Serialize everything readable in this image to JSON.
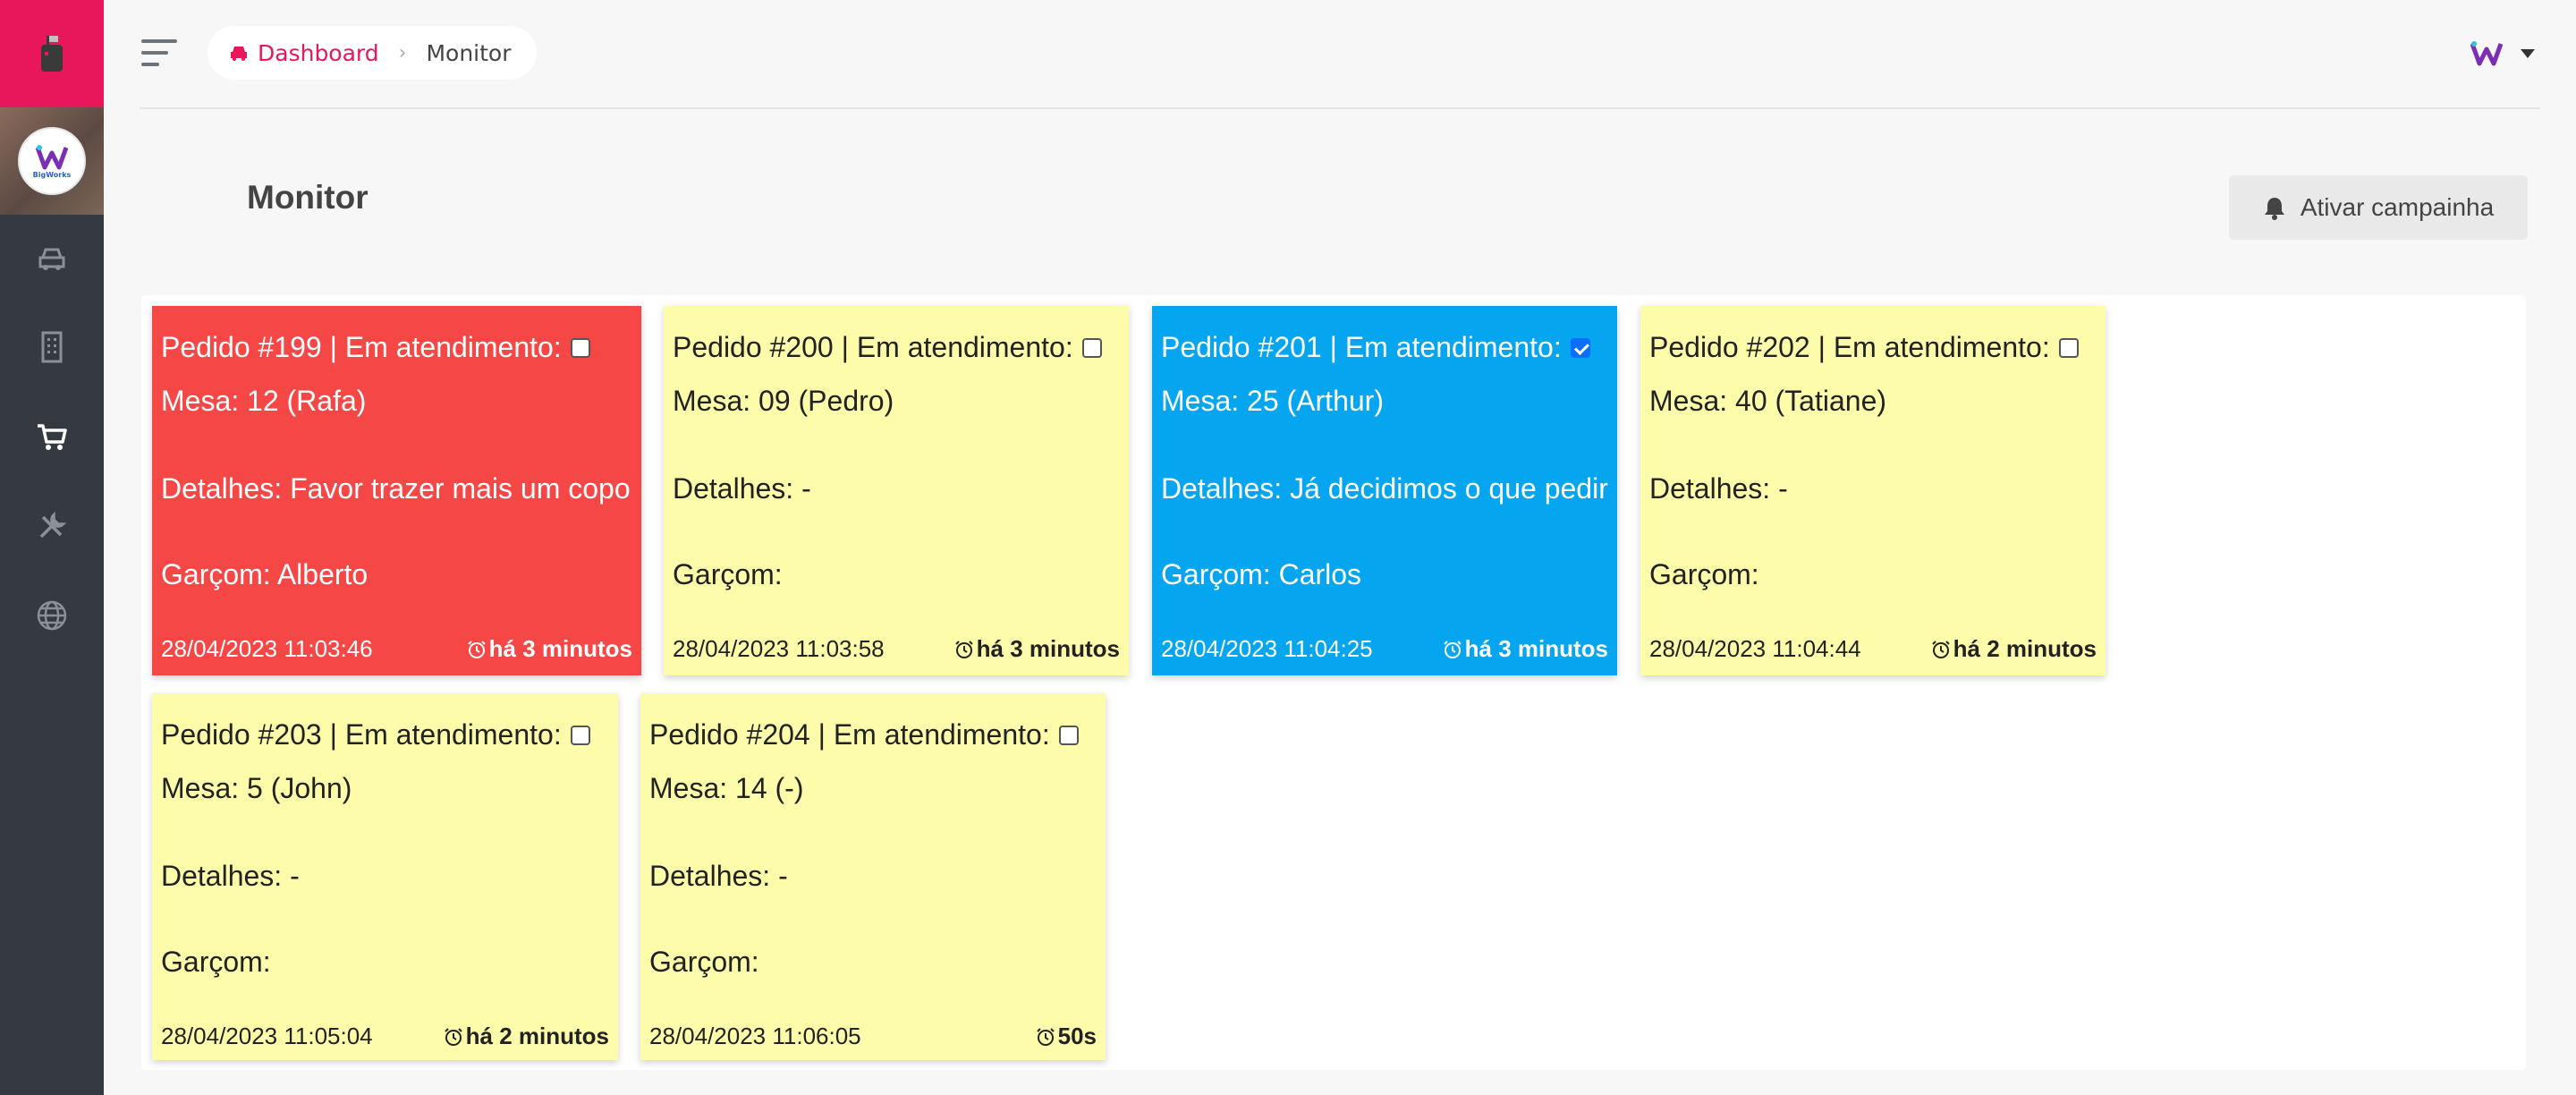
{
  "header": {
    "breadcrumb_home": "Dashboard",
    "breadcrumb_current": "Monitor"
  },
  "page": {
    "title": "Monitor",
    "campaign_button": "Ativar campainha"
  },
  "colors": {
    "brand": "#e8165b",
    "sidebar": "#343a40",
    "card_red": "#f64747",
    "card_yellow": "#fdfcaa",
    "card_blue": "#05a5ef"
  },
  "sidebar_icons": [
    "car-icon",
    "building-icon",
    "cart-icon",
    "tools-icon",
    "globe-icon"
  ],
  "orders": [
    {
      "title": "Pedido #199 | Em atendimento:",
      "checked": false,
      "mesa": "Mesa: 12 (Rafa)",
      "detalhes": "Detalhes: Favor trazer mais um copo",
      "garcom": "Garçom: Alberto",
      "datetime": "28/04/2023 11:03:46",
      "elapsed": "há 3 minutos",
      "status_color": "red"
    },
    {
      "title": "Pedido #200 | Em atendimento:",
      "checked": false,
      "mesa": "Mesa: 09 (Pedro)",
      "detalhes": "Detalhes: -",
      "garcom": "Garçom:",
      "datetime": "28/04/2023 11:03:58",
      "elapsed": "há 3 minutos",
      "status_color": "yellow"
    },
    {
      "title": "Pedido #201 | Em atendimento:",
      "checked": true,
      "mesa": "Mesa: 25 (Arthur)",
      "detalhes": "Detalhes: Já decidimos o que pedir",
      "garcom": "Garçom: Carlos",
      "datetime": "28/04/2023 11:04:25",
      "elapsed": "há 3 minutos",
      "status_color": "blue"
    },
    {
      "title": "Pedido #202 | Em atendimento:",
      "checked": false,
      "mesa": "Mesa: 40 (Tatiane)",
      "detalhes": "Detalhes: -",
      "garcom": "Garçom:",
      "datetime": "28/04/2023 11:04:44",
      "elapsed": "há 2 minutos",
      "status_color": "yellow"
    },
    {
      "title": "Pedido #203 | Em atendimento:",
      "checked": false,
      "mesa": "Mesa: 5 (John)",
      "detalhes": "Detalhes: -",
      "garcom": "Garçom:",
      "datetime": "28/04/2023 11:05:04",
      "elapsed": "há 2 minutos",
      "status_color": "yellow"
    },
    {
      "title": "Pedido #204 | Em atendimento:",
      "checked": false,
      "mesa": "Mesa: 14 (-)",
      "detalhes": "Detalhes: -",
      "garcom": "Garçom:",
      "datetime": "28/04/2023 11:06:05",
      "elapsed": "50s",
      "status_color": "yellow"
    }
  ]
}
